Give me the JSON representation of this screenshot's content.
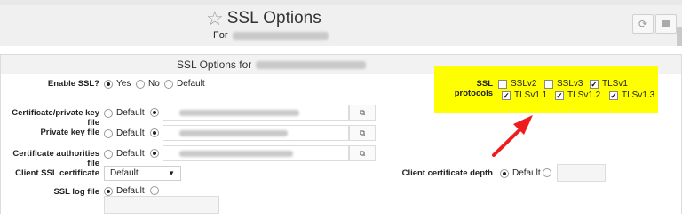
{
  "header": {
    "title": "SSL Options",
    "for_label": "For",
    "star_icon": "star-outline-icon",
    "refresh_icon": "refresh-icon",
    "stop_icon": "stop-icon"
  },
  "panel": {
    "title": "SSL Options for"
  },
  "enable_ssl": {
    "label": "Enable SSL?",
    "options": [
      "Yes",
      "No",
      "Default"
    ],
    "selected": "Yes"
  },
  "cert_file": {
    "label": "Certificate/private key file",
    "default_label": "Default",
    "selected": "custom"
  },
  "private_key": {
    "label": "Private key file",
    "default_label": "Default",
    "selected": "custom"
  },
  "ca_file": {
    "label": "Certificate authorities file",
    "default_label": "Default",
    "selected": "custom"
  },
  "client_cert": {
    "label": "Client SSL certificate",
    "value": "Default"
  },
  "ssl_log": {
    "label": "SSL log file",
    "default_label": "Default",
    "selected": "Default"
  },
  "ssl_protocols": {
    "label": "SSL protocols",
    "items": [
      {
        "name": "SSLv2",
        "checked": false
      },
      {
        "name": "SSLv3",
        "checked": false
      },
      {
        "name": "TLSv1",
        "checked": true
      },
      {
        "name": "TLSv1.1",
        "checked": true
      },
      {
        "name": "TLSv1.2",
        "checked": true
      },
      {
        "name": "TLSv1.3",
        "checked": true
      }
    ],
    "highlight_color": "#ffff00"
  },
  "client_depth": {
    "label": "Client certificate depth",
    "default_label": "Default",
    "selected": "Default"
  },
  "colors": {
    "arrow": "#ee1c1c",
    "header_bg": "#f0f0f0"
  },
  "icons": {
    "file_picker": "file-picker-icon"
  }
}
